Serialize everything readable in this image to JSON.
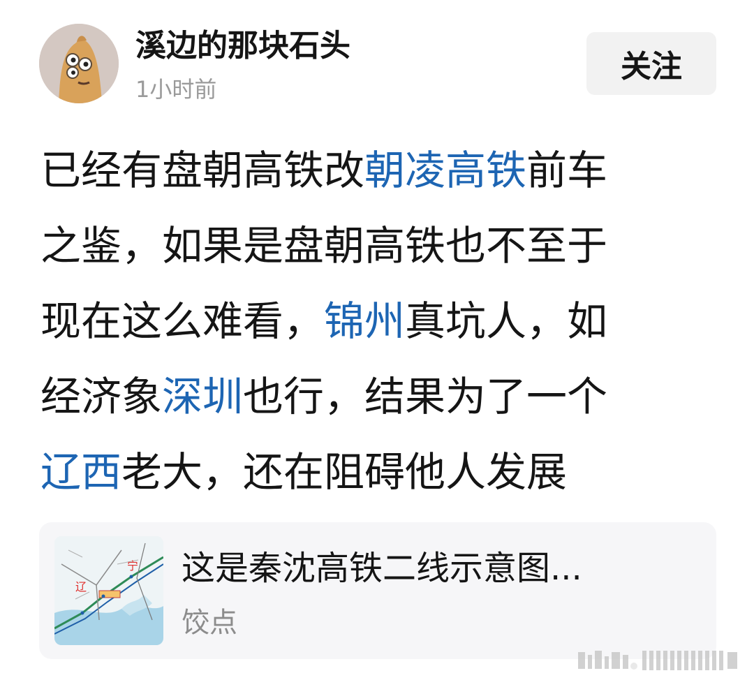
{
  "author": {
    "name": "溪边的那块石头",
    "time": "1小时前"
  },
  "follow": {
    "label": "关注"
  },
  "post": {
    "lines": [
      [
        {
          "text": "已经有盘朝高铁改"
        },
        {
          "text": "朝凌高铁",
          "tag": true
        },
        {
          "text": "前车"
        }
      ],
      [
        {
          "text": "之鉴，如果是盘朝高铁也不至于"
        }
      ],
      [
        {
          "text": "现在这么难看，"
        },
        {
          "text": "锦州",
          "tag": true
        },
        {
          "text": "真坑人，如"
        }
      ],
      [
        {
          "text": "经济象"
        },
        {
          "text": "深圳",
          "tag": true
        },
        {
          "text": "也行，结果为了一个"
        }
      ],
      [
        {
          "text": "辽西",
          "tag": true
        },
        {
          "text": "老大，还在阻碍他人发展"
        }
      ]
    ]
  },
  "link_card": {
    "title": "这是秦沈高铁二线示意图...",
    "source": "饺点",
    "thumb_labels": [
      "辽",
      "宁"
    ]
  },
  "colors": {
    "tag": "#1d65b3",
    "text": "#151515",
    "muted": "#9a9a9a"
  }
}
